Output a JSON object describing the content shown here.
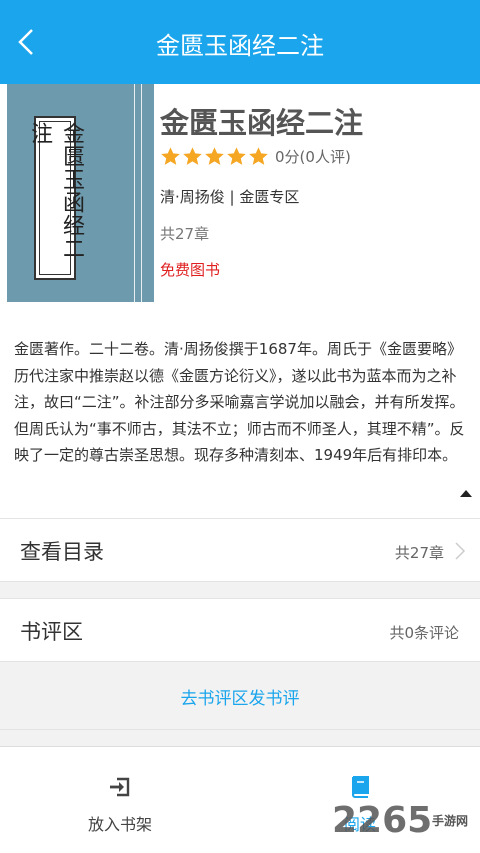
{
  "header": {
    "title": "金匮玉函经二注",
    "back_icon": "back-chevron-icon"
  },
  "book": {
    "cover_text": "金匮玉函经二注",
    "title": "金匮玉函经二注",
    "rating_stars": 5,
    "rating_text": "0分(0人评)",
    "author_line": "清·周扬俊 | 金匮专区",
    "chapters": "共27章",
    "price_label": "免费图书",
    "cover_color": "#6e9aad",
    "star_color": "#f5a623"
  },
  "description": "金匮著作。二十二卷。清·周扬俊撰于1687年。周氏于《金匮要略》历代注家中推崇赵以德《金匮方论衍义》，遂以此书为蓝本而为之补注，故曰“二注”。补注部分多采喻嘉言学说加以融会，并有所发挥。但周氏认为“事不师古，其法不立；师古而不师圣人，其理不精”。反映了一定的尊古崇圣思想。现存多种清刻本、1949年后有排印本。",
  "toc_row": {
    "label": "查看目录",
    "count": "共27章"
  },
  "review_row": {
    "label": "书评区",
    "count": "共0条评论"
  },
  "review_link": "去书评区发书评",
  "bottom_bar": {
    "shelf_label": "放入书架",
    "read_label": "阅读"
  },
  "watermark": {
    "number": "2265",
    "site": "手游网"
  },
  "colors": {
    "accent": "#1aa5ec",
    "free": "#e02020"
  }
}
